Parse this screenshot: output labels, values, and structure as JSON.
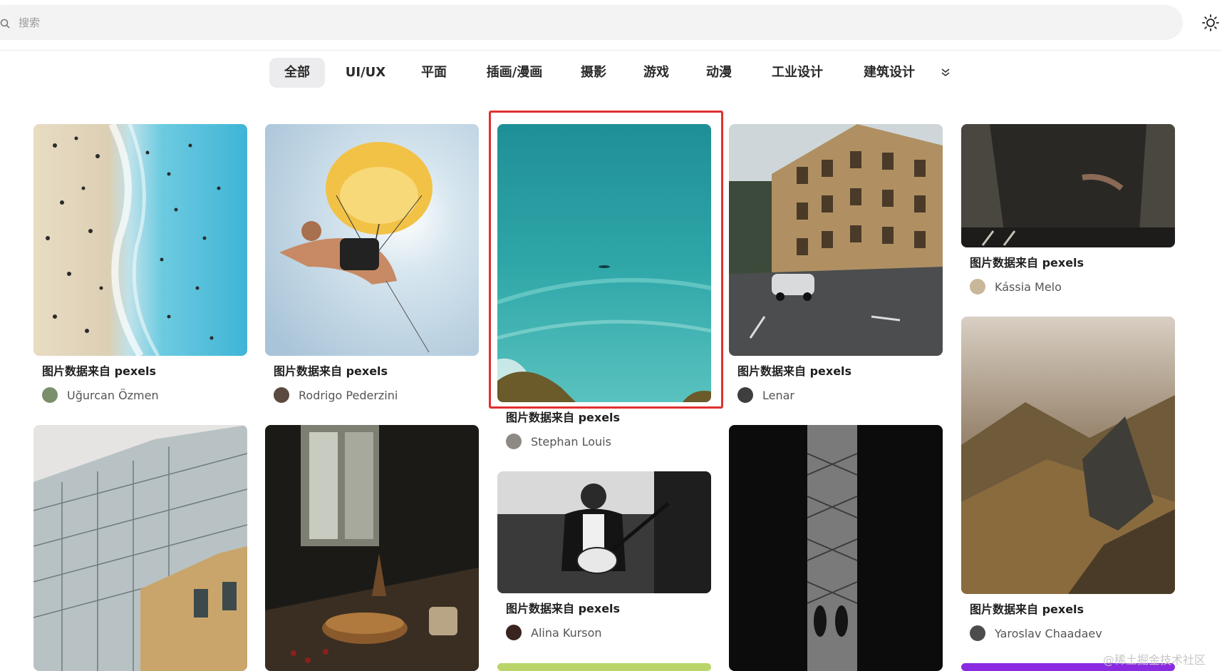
{
  "search": {
    "placeholder": "搜索",
    "value": ""
  },
  "icons": {
    "search": "search-icon",
    "theme": "sun-icon",
    "more": "chevrons-down-icon"
  },
  "tabs": [
    {
      "label": "全部",
      "active": true
    },
    {
      "label": "UI/UX",
      "active": false
    },
    {
      "label": "平面",
      "active": false
    },
    {
      "label": "插画/漫画",
      "active": false
    },
    {
      "label": "摄影",
      "active": false
    },
    {
      "label": "游戏",
      "active": false
    },
    {
      "label": "动漫",
      "active": false
    },
    {
      "label": "工业设计",
      "active": false
    },
    {
      "label": "建筑设计",
      "active": false
    }
  ],
  "cards": [
    {
      "caption": "图片数据来自 pexels",
      "author": "Uğurcan Özmen",
      "image": "beach-aerial"
    },
    {
      "caption": "图片数据来自 pexels",
      "author": "Rodrigo Pederzini",
      "image": "paraglider"
    },
    {
      "caption": "图片数据来自 pexels",
      "author": "Stephan Louis",
      "image": "turquoise-sea",
      "selected": true
    },
    {
      "caption": "图片数据来自 pexels",
      "author": "Lenar",
      "image": "city-street"
    },
    {
      "caption": "图片数据来自 pexels",
      "author": "Kássia Melo",
      "image": "seated-person"
    },
    {
      "caption": "图片数据来自 pexels",
      "author": "Yaroslav Chaadaev",
      "image": "mountain-landscape"
    },
    {
      "caption": "图片数据来自 pexels",
      "author": "Alina Kurson",
      "image": "guitarist"
    },
    {
      "caption": "",
      "author": "",
      "image": "glass-building"
    },
    {
      "caption": "",
      "author": "",
      "image": "window-table"
    },
    {
      "caption": "",
      "author": "",
      "image": "dark-hallway"
    }
  ],
  "colors": {
    "highlight": "#e0302f",
    "active_tab_bg": "#ececee"
  },
  "watermark": "@稀土掘金技术社区"
}
